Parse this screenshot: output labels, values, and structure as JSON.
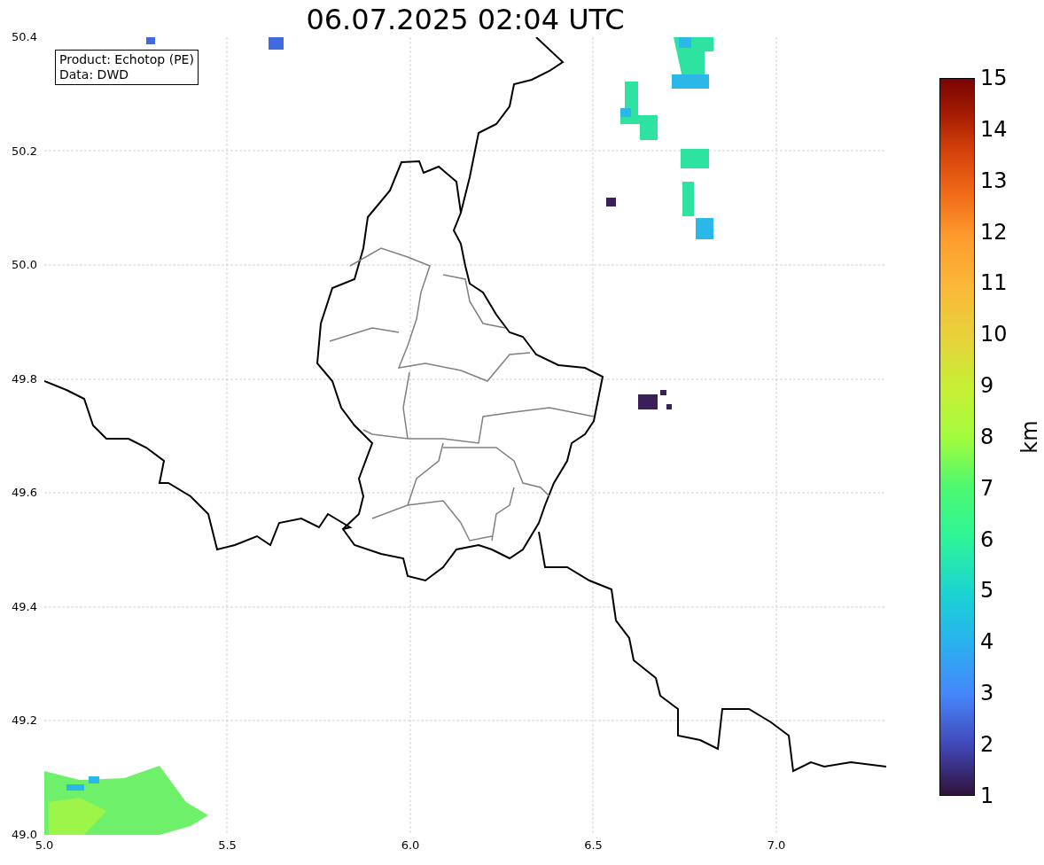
{
  "title": "06.07.2025 02:04 UTC",
  "legend": [
    "Product: Echotop (PE)",
    "Data: DWD"
  ],
  "y_axis": {
    "ticks": [
      "50.4",
      "50.2",
      "50.0",
      "49.8",
      "49.6",
      "49.4",
      "49.2",
      "49.0"
    ]
  },
  "x_axis": {
    "ticks": [
      "5.0",
      "5.5",
      "6.0",
      "6.5",
      "7.0"
    ]
  },
  "colorbar": {
    "label": "km",
    "ticks": [
      "15",
      "14",
      "13",
      "12",
      "11",
      "10",
      "9",
      "8",
      "7",
      "6",
      "5",
      "4",
      "3",
      "2",
      "1"
    ]
  }
}
